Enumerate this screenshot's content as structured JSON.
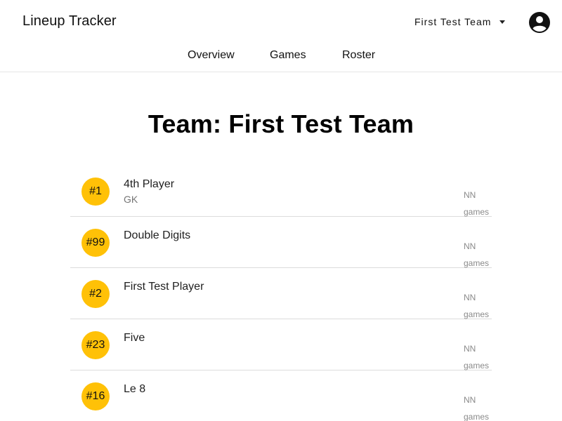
{
  "header": {
    "app_title": "Lineup Tracker",
    "team_selector": {
      "selected": "First Test Team",
      "icon": "arrow-drop-down-icon"
    },
    "account_icon": "account-circle-icon"
  },
  "nav": {
    "tabs": [
      {
        "label": "Overview"
      },
      {
        "label": "Games"
      },
      {
        "label": "Roster"
      }
    ]
  },
  "main": {
    "title": "Team: First Test Team",
    "players": [
      {
        "number": "#1",
        "name": "4th Player",
        "position": "GK",
        "games_value": "NN",
        "games_label": "games"
      },
      {
        "number": "#99",
        "name": "Double Digits",
        "position": "",
        "games_value": "NN",
        "games_label": "games"
      },
      {
        "number": "#2",
        "name": "First Test Player",
        "position": "",
        "games_value": "NN",
        "games_label": "games"
      },
      {
        "number": "#23",
        "name": "Five",
        "position": "",
        "games_value": "NN",
        "games_label": "games"
      },
      {
        "number": "#16",
        "name": "Le 8",
        "position": "",
        "games_value": "NN",
        "games_label": "games"
      }
    ]
  },
  "colors": {
    "badge": "#ffc107",
    "divider": "#dcdcdc"
  }
}
